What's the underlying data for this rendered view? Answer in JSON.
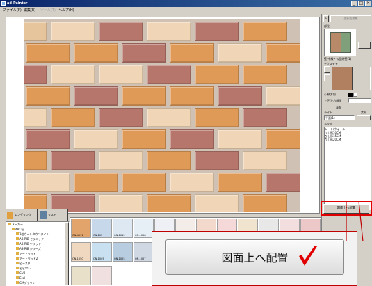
{
  "window": {
    "title": "ad-Painter",
    "min_glyph": "_",
    "max_glyph": "□",
    "close_glyph": "×"
  },
  "menubar": {
    "items": [
      "ファイル(F)",
      "編集(E)",
      "ツール(T)",
      "ヘルプ(H)"
    ]
  },
  "right_panel": {
    "top_button": "選択面編集",
    "section_label": "部位",
    "preview_caption": "壁-中級・公園外壁(1)",
    "texture_label": "テクスチャ",
    "radio_label": "柄方向",
    "width_label": "上下/左右間隔",
    "surface_title": "表面",
    "list_header_left": "ライト",
    "list_header_right": "素材",
    "dropdown_value": "平面(1)",
    "list2_title": "ラベル",
    "list2_items": [
      "シート/ウォール",
      "ひし形10CM",
      "ひし形15CM",
      "ひし形20CM"
    ],
    "place_button": "図面上へ配置"
  },
  "bottom_panel": {
    "tab_rendering": "レンダリング",
    "tab_list": "リスト",
    "tree_items": [
      "メーカー",
      "ABC社",
      "3倍ウールタウンタイル",
      "AB-RIB セラミック",
      "AB-RIB ソリッド",
      "AB-RIB シリーズ",
      "アートウッド",
      "アートウッド2",
      "ピース(1)",
      "ヒビワレ",
      "CUB",
      "Ecol",
      "GMブラウン"
    ],
    "thumb_labels": [
      "ON-4011",
      "ON-105",
      "ON-1015",
      "ON-1028",
      "ON-1050",
      "ON-1005",
      "ON-1025",
      "ON-1027"
    ]
  },
  "callout": {
    "button_label": "図面上へ配置",
    "check_glyph": "✔"
  },
  "colors": {
    "title_bar_left": "#0a246a",
    "title_bar_right": "#3a6ea5",
    "brick_orange": "#e09a58",
    "brick_red": "#b6766c",
    "brick_cream": "#f0d6b6",
    "brick_beige": "#e6c49c",
    "mortar": "#cfc2b4",
    "highlight_red": "#e00000"
  },
  "brick_wall": {
    "rows": [
      [
        "beige",
        "cream",
        "red",
        "cream",
        "red",
        "orange"
      ],
      [
        "orange",
        "orange",
        "red",
        "orange",
        "cream",
        "orange",
        "cream"
      ],
      [
        "red",
        "cream",
        "cream",
        "red",
        "orange",
        "orange"
      ],
      [
        "orange",
        "red",
        "orange",
        "orange",
        "red",
        "cream",
        "beige"
      ],
      [
        "cream",
        "orange",
        "red",
        "cream",
        "orange",
        "red"
      ],
      [
        "red",
        "cream",
        "orange",
        "red",
        "cream",
        "orange",
        "red"
      ],
      [
        "orange",
        "red",
        "cream",
        "orange",
        "red",
        "cream"
      ],
      [
        "cream",
        "orange",
        "orange",
        "cream",
        "orange",
        "red",
        "orange"
      ],
      [
        "orange",
        "red",
        "cream",
        "orange",
        "cream",
        "orange"
      ]
    ]
  },
  "thumb_colors": [
    "#e2a46a",
    "#c7d8ea",
    "#dde8f2",
    "#e6eef6",
    "#eef0f6",
    "#f3ece8",
    "#f2d9cc",
    "#f5d8d8",
    "#f0e4cf",
    "#e8e8e8",
    "#f2dede",
    "#ecc8c8",
    "#f4e0d4",
    "#f0d8c0",
    "#c8e0f0",
    "#b9cde0",
    "#d0d8e4",
    "#e2e6ee",
    "#f0e6da",
    "#e6d8d0",
    "#dadada",
    "#eae0d8",
    "#e2e8f0",
    "#f0ece8",
    "#d8e4ee",
    "#ecd8c8",
    "#e8e0c8",
    "#f0e0e0"
  ]
}
